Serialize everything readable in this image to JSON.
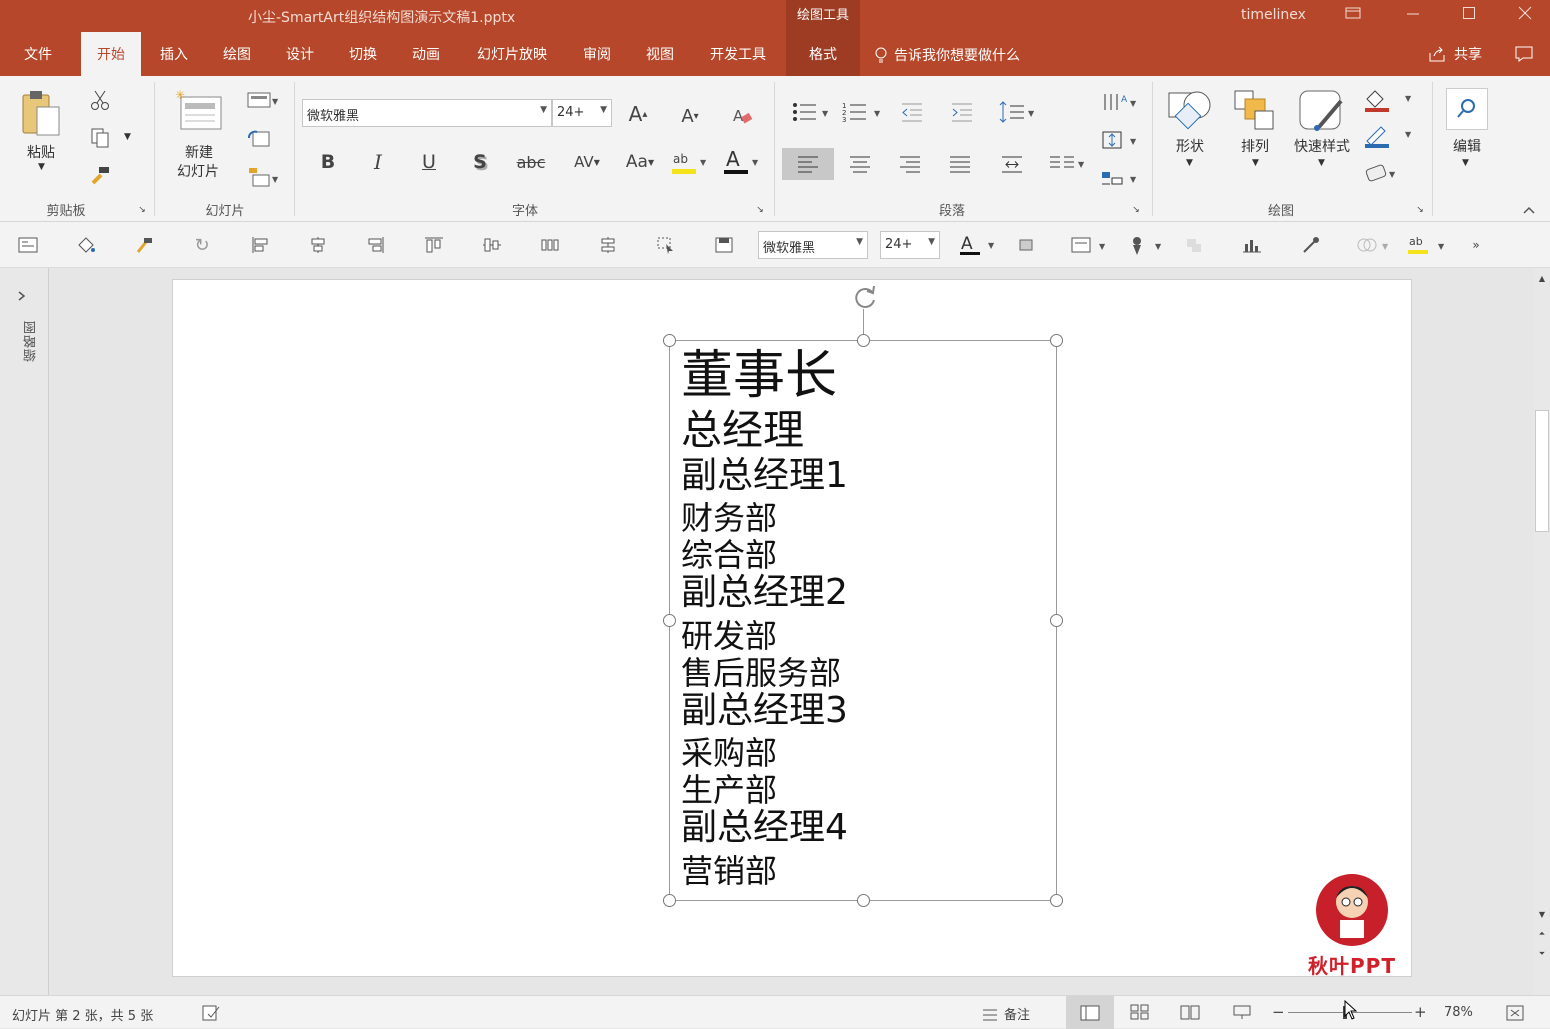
{
  "window": {
    "title": "小尘-SmartArt组织结构图演示文稿1.pptx",
    "context_tab_group": "绘图工具",
    "user": "timelinex",
    "buttons": [
      "ribbon-display-icon",
      "minimize-icon",
      "maximize-icon",
      "close-icon"
    ]
  },
  "tabs": [
    "文件",
    "开始",
    "插入",
    "绘图",
    "设计",
    "切换",
    "动画",
    "幻灯片放映",
    "审阅",
    "视图",
    "开发工具",
    "格式"
  ],
  "active_tab": "开始",
  "tell_me": "告诉我你想要做什么",
  "share": "共享",
  "ribbon": {
    "clipboard": {
      "paste": "粘贴",
      "label": "剪贴板"
    },
    "slides": {
      "new_slide_line1": "新建",
      "new_slide_line2": "幻灯片",
      "label": "幻灯片"
    },
    "font": {
      "family": "微软雅黑",
      "size": "24+",
      "label": "字体"
    },
    "paragraph": {
      "label": "段落"
    },
    "drawing": {
      "shape": "形状",
      "arrange": "排列",
      "quick_styles": "快速样式",
      "label": "绘图"
    },
    "editing": {
      "edit": "编辑"
    }
  },
  "qat": {
    "font_family": "微软雅黑",
    "font_size": "24+"
  },
  "left_panel": {
    "label": "缩略图"
  },
  "slide": {
    "lines": [
      {
        "text": "董事长",
        "size": 54
      },
      {
        "text": "总经理",
        "size": 42
      },
      {
        "text": "副总经理1",
        "size": 36
      },
      {
        "text": "财务部",
        "size": 32
      },
      {
        "text": "综合部",
        "size": 32
      },
      {
        "text": "副总经理2",
        "size": 36
      },
      {
        "text": "研发部",
        "size": 32
      },
      {
        "text": "售后服务部",
        "size": 32
      },
      {
        "text": "副总经理3",
        "size": 36
      },
      {
        "text": "采购部",
        "size": 32
      },
      {
        "text": "生产部",
        "size": 32
      },
      {
        "text": "副总经理4",
        "size": 36
      },
      {
        "text": "营销部",
        "size": 32
      }
    ],
    "watermark": "秋叶PPT"
  },
  "status": {
    "slide_info": "幻灯片 第 2 张，共 5 张",
    "notes": "备注",
    "zoom": "78%",
    "zoom_level": 0.46
  },
  "colors": {
    "accent": "#b7472a",
    "accent_dark": "#9e3b23"
  }
}
